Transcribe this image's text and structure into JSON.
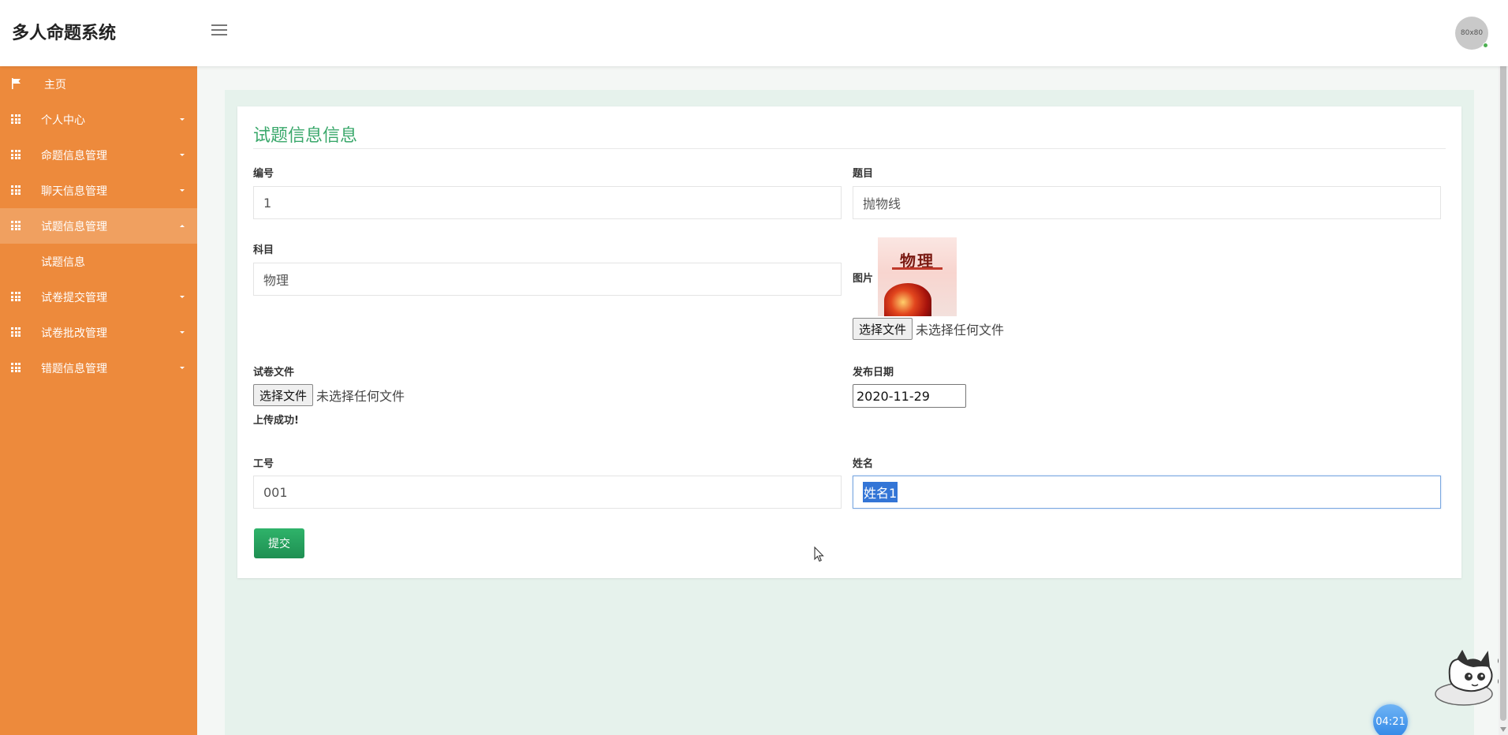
{
  "app": {
    "title": "多人命题系统"
  },
  "header": {
    "avatar_text": "80x80"
  },
  "sidebar": {
    "items": [
      {
        "label": "主页"
      },
      {
        "label": "个人中心"
      },
      {
        "label": "命题信息管理"
      },
      {
        "label": "聊天信息管理"
      },
      {
        "label": "试题信息管理",
        "expanded": true,
        "children": [
          {
            "label": "试题信息"
          }
        ]
      },
      {
        "label": "试卷提交管理"
      },
      {
        "label": "试卷批改管理"
      },
      {
        "label": "错题信息管理"
      }
    ]
  },
  "form": {
    "title": "试题信息信息",
    "fields": {
      "number": {
        "label": "编号",
        "value": "1"
      },
      "question": {
        "label": "题目",
        "value": "抛物线"
      },
      "subject": {
        "label": "科目",
        "value": "物理"
      },
      "image": {
        "label": "图片",
        "thumb_title": "物理",
        "file_button": "选择文件",
        "file_status": "未选择任何文件"
      },
      "paper_file": {
        "label": "试卷文件",
        "file_button": "选择文件",
        "file_status": "未选择任何文件",
        "upload_status": "上传成功!"
      },
      "publish_date": {
        "label": "发布日期",
        "value": "2020-11-29"
      },
      "staff_id": {
        "label": "工号",
        "value": "001"
      },
      "name": {
        "label": "姓名",
        "value": "姓名1"
      }
    },
    "submit_label": "提交"
  },
  "widget": {
    "timer": "04:21"
  },
  "colors": {
    "sidebar": "#ed8a3c",
    "accent": "#3aa86b",
    "submit": "#1e8f52",
    "content_bg": "#e6f2ec"
  }
}
